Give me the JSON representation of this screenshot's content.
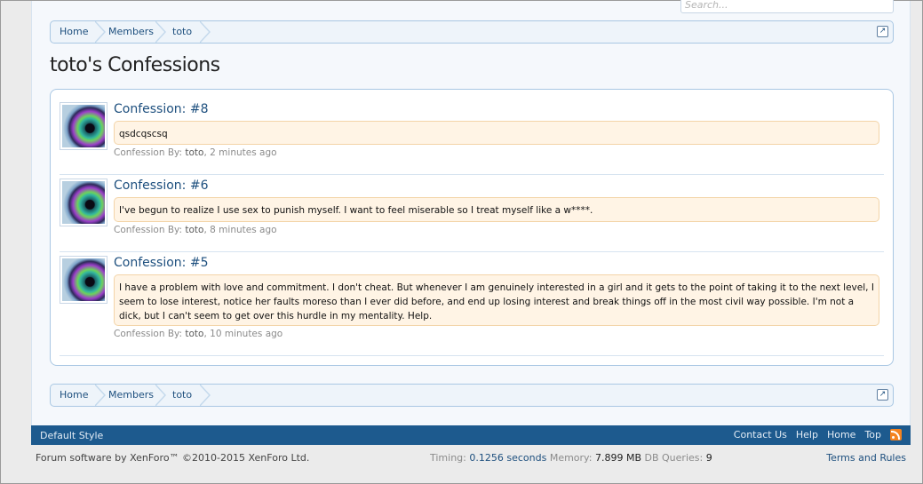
{
  "header": {
    "search_placeholder": "Search..."
  },
  "breadcrumb": {
    "items": [
      "Home",
      "Members",
      "toto"
    ]
  },
  "page": {
    "title": "toto's Confessions"
  },
  "confessions": [
    {
      "title": "Confession: #8",
      "body": "qsdcqscsq",
      "meta_prefix": "Confession By:",
      "author": "toto",
      "time": ", 2 minutes ago"
    },
    {
      "title": "Confession: #6",
      "body": "I've begun to realize I use sex to punish myself. I want to feel miserable so I treat myself like a w****.",
      "meta_prefix": "Confession By:",
      "author": "toto",
      "time": ", 8 minutes ago"
    },
    {
      "title": "Confession: #5",
      "body": "I have a problem with love and commitment. I don't cheat. But whenever I am genuinely interested in a girl and it gets to the point of taking it to the next level, I seem to lose interest, notice her faults moreso than I ever did before, and end up losing interest and break things off in the most civil way possible. I'm not a dick, but I can't seem to get over this hurdle in my mentality. Help.",
      "meta_prefix": "Confession By:",
      "author": "toto",
      "time": ", 10 minutes ago"
    }
  ],
  "footer": {
    "style_label": "Default Style",
    "links": [
      "Contact Us",
      "Help",
      "Home",
      "Top"
    ],
    "rss_icon": "rss-icon"
  },
  "bottom": {
    "copyright": "Forum software by XenForo™ ©2010-2015 XenForo Ltd.",
    "timing_label": "Timing:",
    "timing_value": "0.1256 seconds",
    "memory_label": "Memory:",
    "memory_value": "7.899 MB",
    "queries_label": "DB Queries:",
    "queries_value": "9",
    "terms": "Terms and Rules"
  }
}
